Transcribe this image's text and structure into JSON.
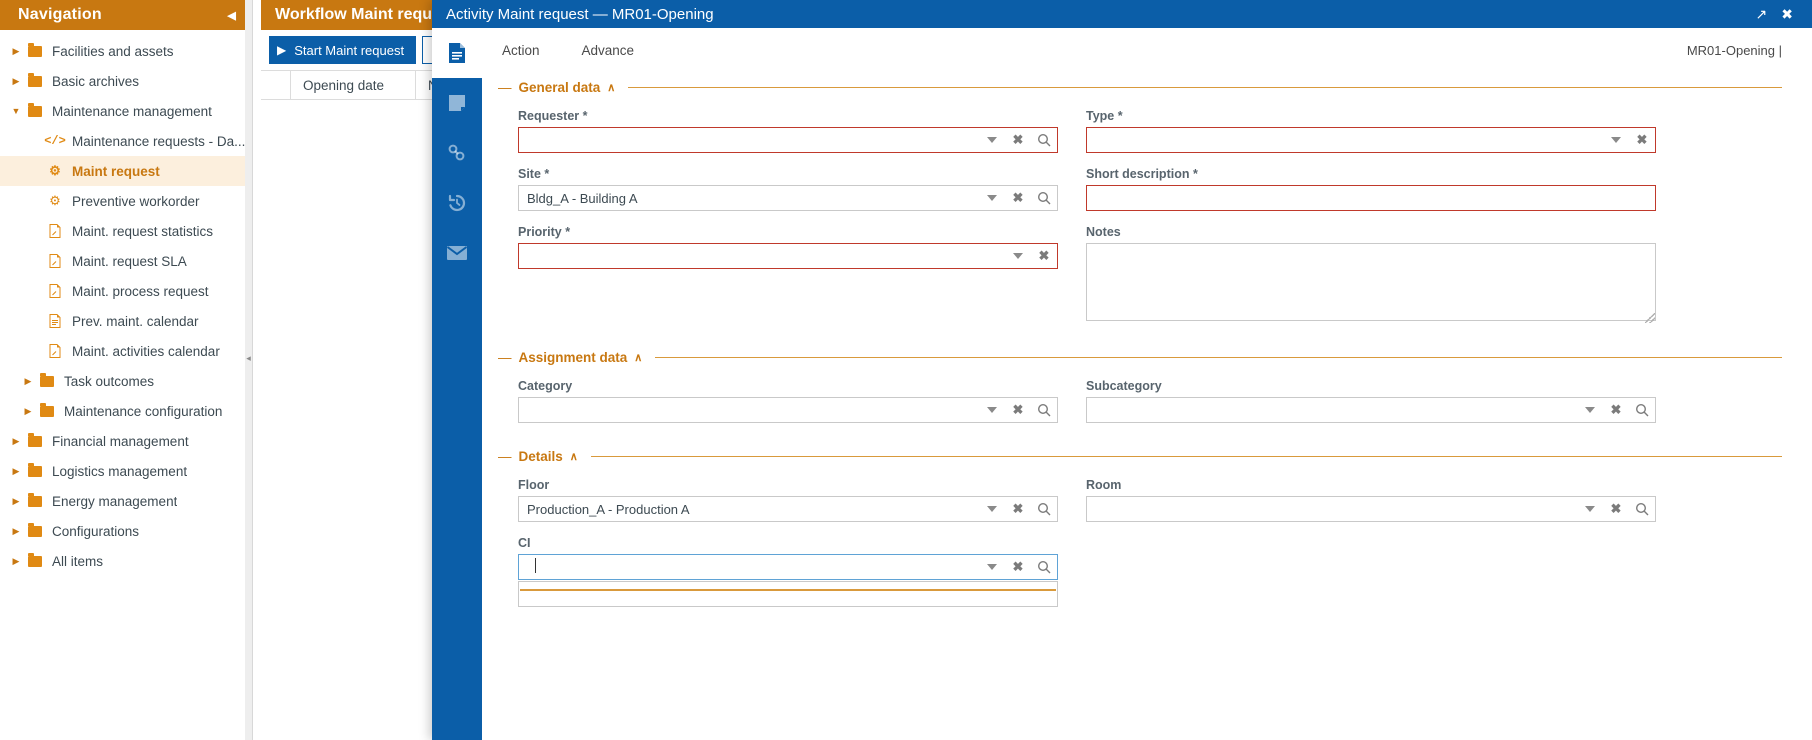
{
  "navigation": {
    "title": "Navigation",
    "collapse_icon": "chevron-left-icon",
    "items": [
      {
        "label": "Facilities and assets",
        "icon": "folder-icon",
        "level": 0,
        "arrow": "right",
        "selected": false
      },
      {
        "label": "Basic archives",
        "icon": "folder-icon",
        "level": 0,
        "arrow": "right",
        "selected": false
      },
      {
        "label": "Maintenance management",
        "icon": "folder-icon",
        "level": 0,
        "arrow": "down",
        "selected": false
      },
      {
        "label": "Maintenance requests - Da...",
        "icon": "code-icon",
        "level": 1,
        "arrow": "none",
        "selected": false
      },
      {
        "label": "Maint request",
        "icon": "gear-icon",
        "level": 1,
        "arrow": "none",
        "selected": true
      },
      {
        "label": "Preventive workorder",
        "icon": "gear-icon",
        "level": 1,
        "arrow": "none",
        "selected": false
      },
      {
        "label": "Maint. request statistics",
        "icon": "pdf-icon",
        "level": 1,
        "arrow": "none",
        "selected": false
      },
      {
        "label": "Maint. request SLA",
        "icon": "pdf-icon",
        "level": 1,
        "arrow": "none",
        "selected": false
      },
      {
        "label": "Maint. process request",
        "icon": "pdf-icon",
        "level": 1,
        "arrow": "none",
        "selected": false
      },
      {
        "label": "Prev. maint. calendar",
        "icon": "report-icon",
        "level": 1,
        "arrow": "none",
        "selected": false
      },
      {
        "label": "Maint. activities calendar",
        "icon": "pdf-icon",
        "level": 1,
        "arrow": "none",
        "selected": false
      },
      {
        "label": "Task outcomes",
        "icon": "folder-icon",
        "level": 1,
        "arrow": "right",
        "selected": false
      },
      {
        "label": "Maintenance configuration",
        "icon": "folder-icon",
        "level": 1,
        "arrow": "right",
        "selected": false
      },
      {
        "label": "Financial management",
        "icon": "folder-icon",
        "level": 0,
        "arrow": "right",
        "selected": false
      },
      {
        "label": "Logistics management",
        "icon": "folder-icon",
        "level": 0,
        "arrow": "right",
        "selected": false
      },
      {
        "label": "Energy management",
        "icon": "folder-icon",
        "level": 0,
        "arrow": "right",
        "selected": false
      },
      {
        "label": "Configurations",
        "icon": "folder-icon",
        "level": 0,
        "arrow": "right",
        "selected": false
      },
      {
        "label": "All items",
        "icon": "folder-icon",
        "level": 0,
        "arrow": "right",
        "selected": false
      }
    ],
    "splitter_handle": "◂"
  },
  "workflow_window": {
    "title": "Workflow Maint request",
    "toolbar": {
      "start_button_label": "Start Maint request",
      "start_button_icon": "play-icon"
    },
    "grid": {
      "columns": [
        "",
        "Opening date",
        "Number"
      ],
      "rows": []
    }
  },
  "modal": {
    "title": "Activity Maint request — MR01-Opening",
    "expand_icon": "expand-icon",
    "close_icon": "close-icon",
    "rail": [
      {
        "name": "document-icon",
        "active": true
      },
      {
        "name": "note-icon",
        "active": false
      },
      {
        "name": "link-icon",
        "active": false
      },
      {
        "name": "history-icon",
        "active": false
      },
      {
        "name": "mail-icon",
        "active": false
      }
    ],
    "menubar": {
      "items": [
        "Action",
        "Advance"
      ],
      "breadcrumb": "MR01-Opening |"
    },
    "sections": [
      {
        "title": "General data",
        "collapsed": false,
        "caret": "∧",
        "fields": [
          {
            "label": "Requester",
            "required": true,
            "value": "",
            "column": "left",
            "type": "lookup",
            "controls": [
              "caret",
              "clear",
              "search"
            ],
            "state": "required-empty"
          },
          {
            "label": "Type",
            "required": true,
            "value": "",
            "column": "right",
            "type": "select",
            "controls": [
              "caret",
              "clear"
            ],
            "state": "required-empty"
          },
          {
            "label": "Site",
            "required": true,
            "value": "Bldg_A - Building A",
            "column": "left",
            "type": "lookup",
            "controls": [
              "caret",
              "clear",
              "search"
            ],
            "state": "filled"
          },
          {
            "label": "Short description",
            "required": true,
            "value": "",
            "column": "right",
            "type": "text",
            "controls": [],
            "state": "required-empty"
          },
          {
            "label": "Priority",
            "required": true,
            "value": "",
            "column": "left",
            "type": "select",
            "controls": [
              "caret",
              "clear"
            ],
            "state": "required-empty"
          },
          {
            "label": "Notes",
            "required": false,
            "value": "",
            "column": "right",
            "type": "textarea",
            "controls": [],
            "state": "empty"
          }
        ]
      },
      {
        "title": "Assignment data",
        "collapsed": false,
        "caret": "∧",
        "fields": [
          {
            "label": "Category",
            "required": false,
            "value": "",
            "column": "left",
            "type": "lookup",
            "controls": [
              "caret",
              "clear",
              "search"
            ],
            "state": "empty"
          },
          {
            "label": "Subcategory",
            "required": false,
            "value": "",
            "column": "right",
            "type": "lookup",
            "controls": [
              "caret",
              "clear",
              "search"
            ],
            "state": "empty"
          }
        ]
      },
      {
        "title": "Details",
        "collapsed": false,
        "caret": "∧",
        "fields": [
          {
            "label": "Floor",
            "required": false,
            "value": "Production_A - Production A",
            "column": "left",
            "type": "lookup",
            "controls": [
              "caret",
              "clear",
              "search"
            ],
            "state": "filled"
          },
          {
            "label": "Room",
            "required": false,
            "value": "",
            "column": "right",
            "type": "lookup",
            "controls": [
              "caret",
              "clear",
              "search"
            ],
            "state": "empty"
          },
          {
            "label": "CI",
            "required": false,
            "value": "",
            "column": "left",
            "type": "lookup",
            "controls": [
              "caret",
              "clear",
              "search"
            ],
            "state": "focused",
            "dropdown_open": true,
            "dropdown_items": []
          }
        ]
      }
    ]
  },
  "colors": {
    "accent_orange": "#C87811",
    "accent_orange_light": "#E08A14",
    "brand_blue": "#0B5EA8",
    "required_red": "#C0392B",
    "focus_blue": "#5FA3D6",
    "selected_row_bg": "#FCEFDD",
    "field_border": "#C9C9C9",
    "label_gray": "#58646D"
  }
}
